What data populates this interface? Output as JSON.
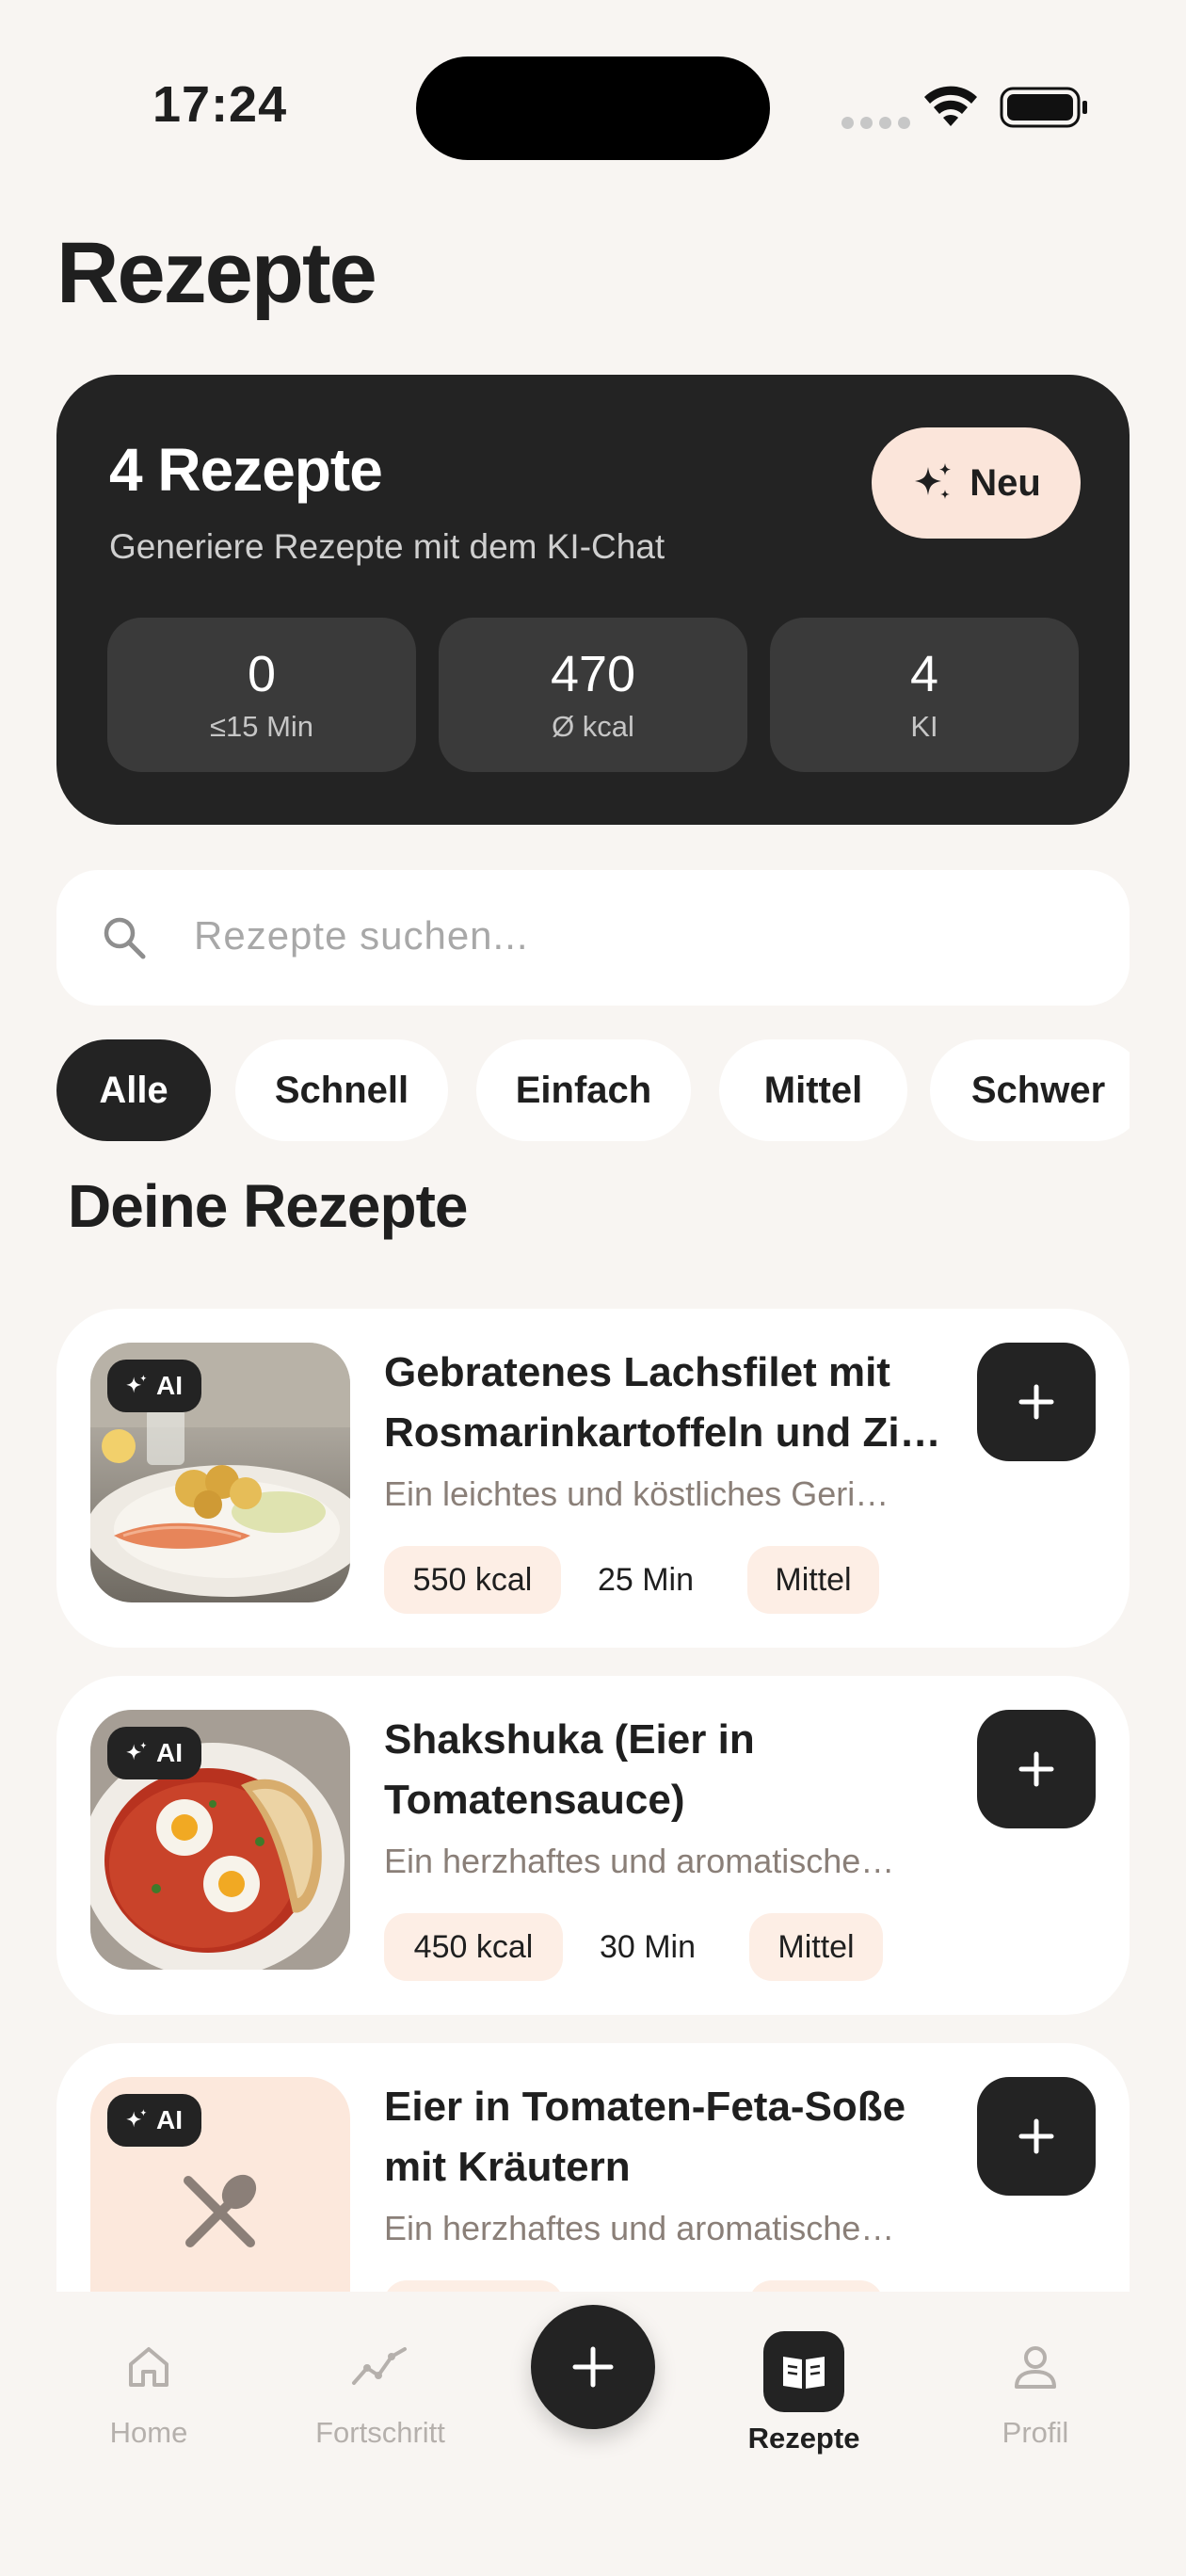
{
  "status_bar": {
    "time": "17:24"
  },
  "page": {
    "title": "Rezepte"
  },
  "hero": {
    "title": "4 Rezepte",
    "subtitle": "Generiere Rezepte mit dem KI-Chat",
    "new_label": "Neu",
    "stats": [
      {
        "value": "0",
        "label": "≤15 Min"
      },
      {
        "value": "470",
        "label": "Ø kcal"
      },
      {
        "value": "4",
        "label": "KI"
      }
    ]
  },
  "search": {
    "placeholder": "Rezepte suchen..."
  },
  "filters": [
    "Alle",
    "Schnell",
    "Einfach",
    "Mittel",
    "Schwer"
  ],
  "filters_active": "Alle",
  "section": {
    "title": "Deine Rezepte"
  },
  "recipes": [
    {
      "badge": "AI",
      "title_line1": "Gebratenes Lachsfilet mit",
      "title_line2": "Rosmarinkartoffeln und Zi…",
      "description": "Ein leichtes und köstliches Geri…",
      "kcal": "550 kcal",
      "time": "25 Min",
      "difficulty": "Mittel"
    },
    {
      "badge": "AI",
      "title_line1": "Shakshuka (Eier in",
      "title_line2": "Tomatensauce)",
      "description": "Ein herzhaftes und aromatische…",
      "kcal": "450 kcal",
      "time": "30 Min",
      "difficulty": "Mittel"
    },
    {
      "badge": "AI",
      "title_line1": "Eier in Tomaten-Feta-Soße",
      "title_line2": "mit Kräutern",
      "description": "Ein herzhaftes und aromatische…"
    }
  ],
  "nav": {
    "items": [
      {
        "label": "Home",
        "icon": "home-icon"
      },
      {
        "label": "Fortschritt",
        "icon": "progress-chart-icon"
      },
      {
        "label": "Rezepte",
        "icon": "book-icon"
      },
      {
        "label": "Profil",
        "icon": "person-icon"
      }
    ],
    "active": "Rezepte"
  },
  "colors": {
    "dark": "#232323",
    "accent_peach": "#fbe5da",
    "background": "#f8f5f2"
  }
}
